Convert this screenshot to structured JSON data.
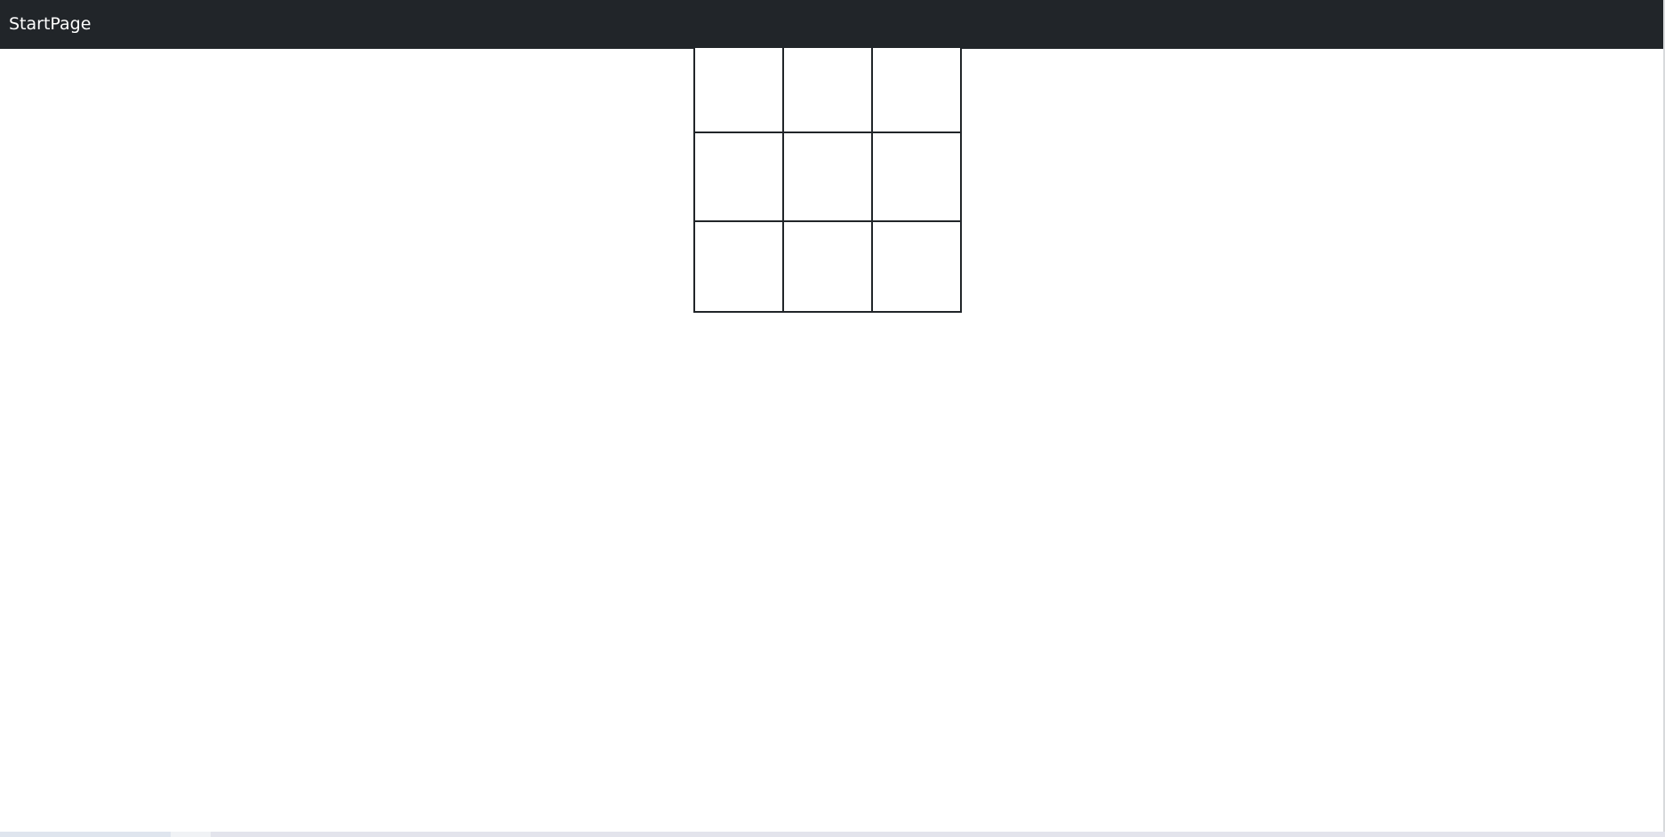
{
  "navbar": {
    "brand": "StartPage",
    "background": "#212529",
    "text_color": "#ffffff"
  },
  "board": {
    "rows": 3,
    "columns": 3,
    "cells": [
      [
        "",
        "",
        ""
      ],
      [
        "",
        "",
        ""
      ],
      [
        "",
        "",
        ""
      ]
    ],
    "line_color": "#212529"
  }
}
